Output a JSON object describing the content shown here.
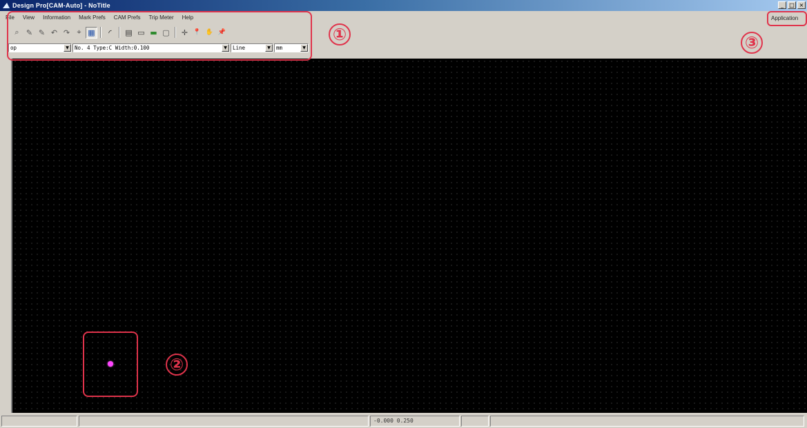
{
  "window": {
    "title": "Design Pro[CAM-Auto] - NoTitle",
    "controls": [
      "_",
      "□",
      "×"
    ]
  },
  "menu": [
    "File",
    "View",
    "Information",
    "Mark Prefs",
    "CAM Prefs",
    "Trip Meter",
    "Help"
  ],
  "toolbar": {
    "icons": [
      "zoom-icon",
      "pencil-icon",
      "pencil-2-icon",
      "undo-icon",
      "redo-icon",
      "snap-icon",
      "grid-icon",
      "arc-icon",
      "measure-icon",
      "ruler-icon",
      "layer-icon",
      "comment-icon",
      "move-icon",
      "pin-icon",
      "hand-icon",
      "pin-2-icon"
    ],
    "glyphs": [
      "⌕",
      "✎",
      "✎",
      "↶",
      "↷",
      "⌖",
      "▦",
      "◜",
      "▤",
      "▭",
      "▬",
      "▢",
      "✛",
      "📍",
      "✋",
      "📌"
    ]
  },
  "combos": {
    "layer": "op",
    "tool": "No.  4 Type:C Width:0.100",
    "linetype": "Line",
    "unit": "mm"
  },
  "app_label": "Application",
  "annotations": [
    "①",
    "②",
    "③"
  ],
  "status": {
    "cell1": "",
    "cell2": "",
    "coords": "-0.000 0.250",
    "cell4": "",
    "cell5": ""
  },
  "colors": {
    "canvas": "#000000",
    "cursor": "#ff44ff",
    "annotation": "#e0334b"
  }
}
